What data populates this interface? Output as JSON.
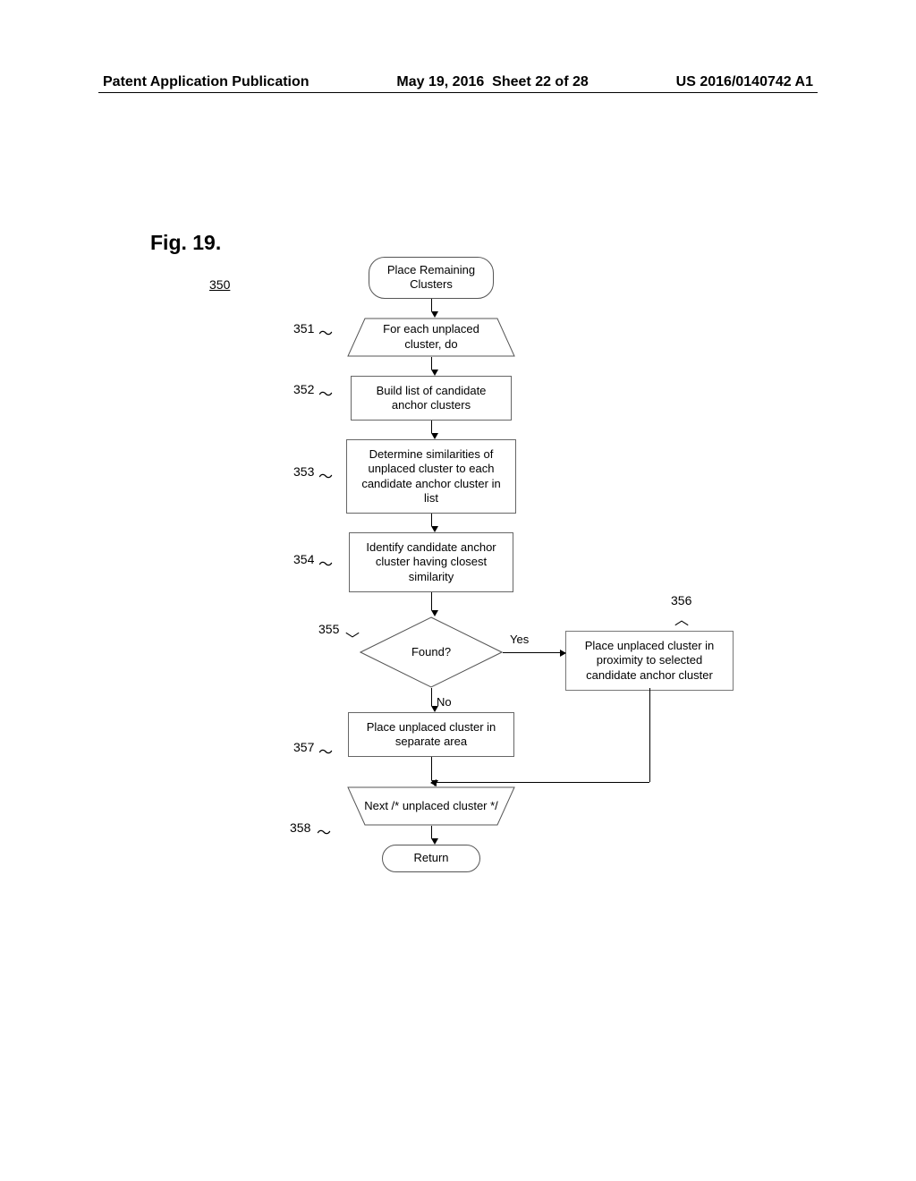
{
  "header": {
    "pub_type": "Patent Application Publication",
    "date": "May 19, 2016",
    "sheet": "Sheet 22 of 28",
    "pub_number": "US 2016/0140742 A1"
  },
  "figure_label": "Fig. 19.",
  "ref_350": "350",
  "nodes": {
    "start": "Place Remaining Clusters",
    "loop_start": "For each unplaced cluster, do",
    "step_352": "Build list of candidate anchor clusters",
    "step_353": "Determine similarities of unplaced cluster to each candidate anchor cluster in list",
    "step_354": "Identify candidate anchor cluster having closest similarity",
    "decision": "Found?",
    "branch_yes": "Yes",
    "branch_no": "No",
    "step_356": "Place unplaced cluster in proximity to selected candidate anchor cluster",
    "step_357": "Place unplaced cluster in separate area",
    "loop_end": "Next /* unplaced cluster */",
    "return": "Return"
  },
  "refs": {
    "r351": "351",
    "r352": "352",
    "r353": "353",
    "r354": "354",
    "r355": "355",
    "r356": "356",
    "r357": "357",
    "r358": "358"
  }
}
